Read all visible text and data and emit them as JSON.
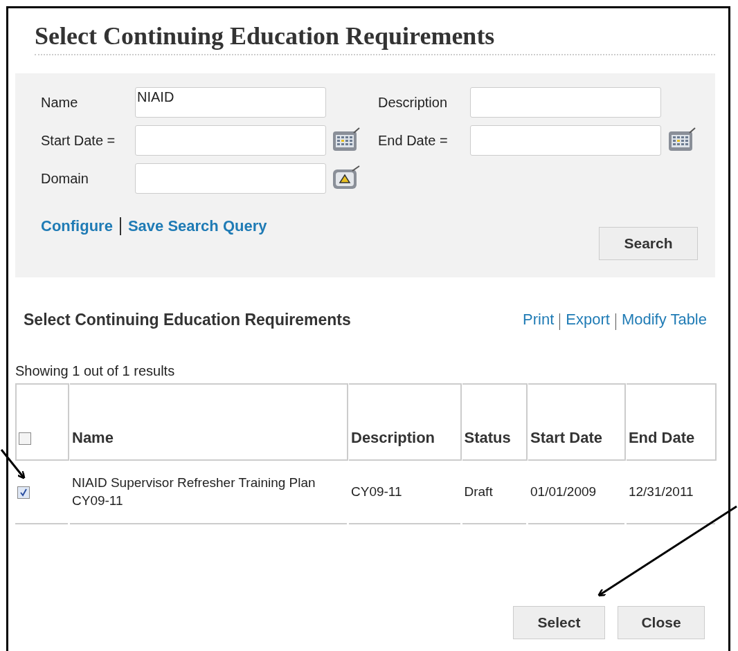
{
  "title": "Select Continuing Education Requirements",
  "search_form": {
    "fields": [
      {
        "label": "Name",
        "value": "NIAID"
      },
      {
        "label": "Description"
      },
      {
        "label": "Start Date =",
        "kind": "calendar"
      },
      {
        "label": "End Date =",
        "kind": "calendar"
      },
      {
        "label": "Domain",
        "kind": "lookup"
      }
    ],
    "links": [
      "Configure",
      "Save Search Query"
    ],
    "search_button": "Search"
  },
  "results": {
    "heading": "Select Continuing Education Requirements",
    "actions": [
      "Print",
      "Export",
      "Modify Table"
    ],
    "count": "Showing 1 out of 1 results",
    "select_all": {
      "checked": false
    },
    "columns": [
      "Name",
      "Description",
      "Status",
      "Start Date",
      "End Date"
    ],
    "rows": [
      {
        "checked": true,
        "cells": [
          "NIAID Supervisor Refresher Training Plan CY09-11",
          "CY09-11",
          "Draft",
          "01/01/2009",
          "12/31/2011"
        ]
      }
    ]
  },
  "buttons": [
    "Select",
    "Close"
  ]
}
